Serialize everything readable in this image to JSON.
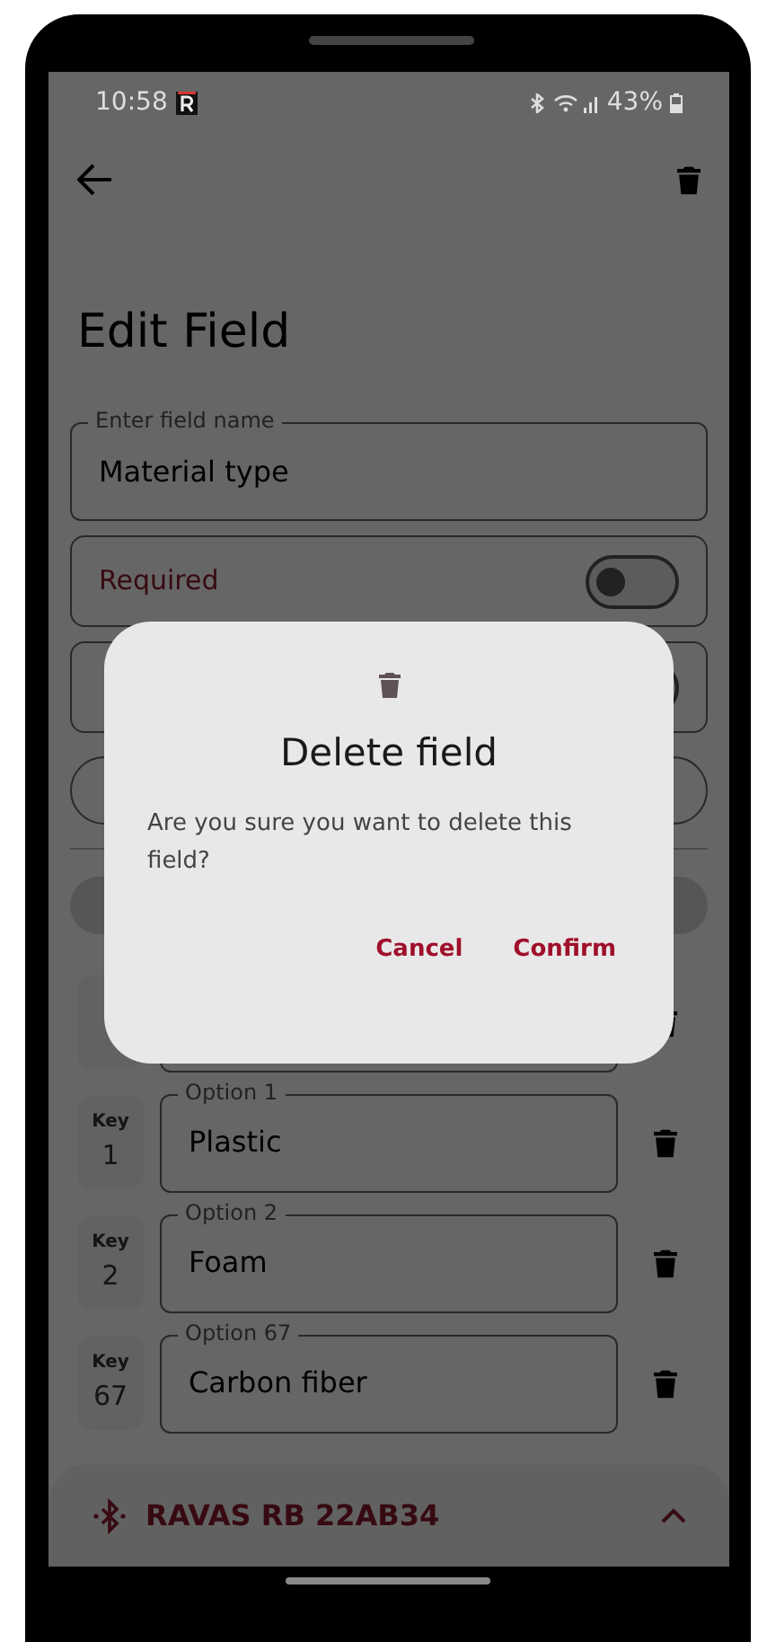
{
  "status_bar": {
    "time": "10:58",
    "battery": "43%"
  },
  "header": {
    "title": "Edit Field"
  },
  "name_field": {
    "label": "Enter field name",
    "value": "Material type"
  },
  "settings": [
    {
      "label": "Required",
      "on": false
    },
    {
      "on": false
    }
  ],
  "options": [
    {
      "key_label": "Key",
      "key": "1",
      "label": "Option 1",
      "value": "Plastic"
    },
    {
      "key_label": "Key",
      "key": "2",
      "label": "Option 2",
      "value": "Foam"
    },
    {
      "key_label": "Key",
      "key": "67",
      "label": "Option 67",
      "value": "Carbon fiber"
    }
  ],
  "device_bar": {
    "name": "RAVAS RB 22AB34",
    "expanded": false
  },
  "dialog": {
    "title": "Delete field",
    "message": "Are you sure you want to delete this field?",
    "buttons": [
      "Cancel",
      "Confirm"
    ]
  }
}
